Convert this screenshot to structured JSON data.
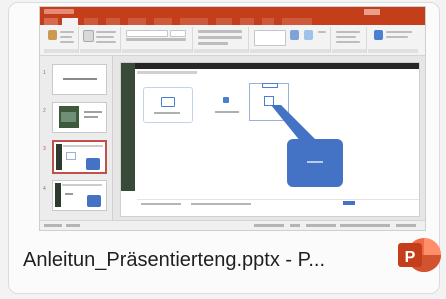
{
  "file": {
    "caption": "Anleitun_Präsentierteng.pptx - P..."
  },
  "app": {
    "icon": "powerpoint-icon",
    "icon_letter": "P",
    "brand_color": "#c43e1c"
  },
  "slides": {
    "numbers": [
      "1",
      "2",
      "3",
      "4"
    ],
    "selected_index": 2
  },
  "colors": {
    "accent_blue": "#4472c4",
    "selection_red": "#c0504d",
    "callout_blue": "#4472c4"
  }
}
